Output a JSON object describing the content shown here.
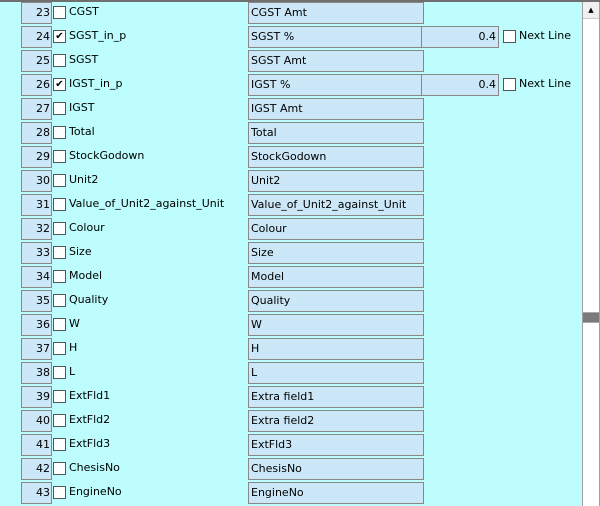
{
  "rows": [
    {
      "num": "23",
      "checked": false,
      "field": "CGST",
      "caption": "CGST Amt"
    },
    {
      "num": "24",
      "checked": true,
      "field": "SGST_in_p",
      "caption": "SGST %",
      "value": "0.4",
      "next_line_label": "Next Line",
      "next_line_checked": false
    },
    {
      "num": "25",
      "checked": false,
      "field": "SGST",
      "caption": "SGST Amt"
    },
    {
      "num": "26",
      "checked": true,
      "field": "IGST_in_p",
      "caption": "IGST %",
      "value": "0.4",
      "next_line_label": "Next Line",
      "next_line_checked": false
    },
    {
      "num": "27",
      "checked": false,
      "field": "IGST",
      "caption": "IGST Amt"
    },
    {
      "num": "28",
      "checked": false,
      "field": "Total",
      "caption": "Total"
    },
    {
      "num": "29",
      "checked": false,
      "field": "StockGodown",
      "caption": "StockGodown"
    },
    {
      "num": "30",
      "checked": false,
      "field": "Unit2",
      "caption": "Unit2"
    },
    {
      "num": "31",
      "checked": false,
      "field": "Value_of_Unit2_against_Unit",
      "caption": "Value_of_Unit2_against_Unit"
    },
    {
      "num": "32",
      "checked": false,
      "field": "Colour",
      "caption": "Colour"
    },
    {
      "num": "33",
      "checked": false,
      "field": "Size",
      "caption": "Size"
    },
    {
      "num": "34",
      "checked": false,
      "field": "Model",
      "caption": "Model"
    },
    {
      "num": "35",
      "checked": false,
      "field": "Quality",
      "caption": "Quality"
    },
    {
      "num": "36",
      "checked": false,
      "field": "W",
      "caption": "W"
    },
    {
      "num": "37",
      "checked": false,
      "field": "H",
      "caption": "H"
    },
    {
      "num": "38",
      "checked": false,
      "field": "L",
      "caption": "L"
    },
    {
      "num": "39",
      "checked": false,
      "field": "ExtFld1",
      "caption": "Extra field1"
    },
    {
      "num": "40",
      "checked": false,
      "field": "ExtFld2",
      "caption": "Extra field2"
    },
    {
      "num": "41",
      "checked": false,
      "field": "ExtFld3",
      "caption": "ExtFld3"
    },
    {
      "num": "42",
      "checked": false,
      "field": "ChesisNo",
      "caption": "ChesisNo"
    },
    {
      "num": "43",
      "checked": false,
      "field": "EngineNo",
      "caption": "EngineNo"
    }
  ],
  "icons": {
    "check": "✔",
    "scroll_up": "▲"
  },
  "scroll": {
    "position_fraction": 0.62
  }
}
